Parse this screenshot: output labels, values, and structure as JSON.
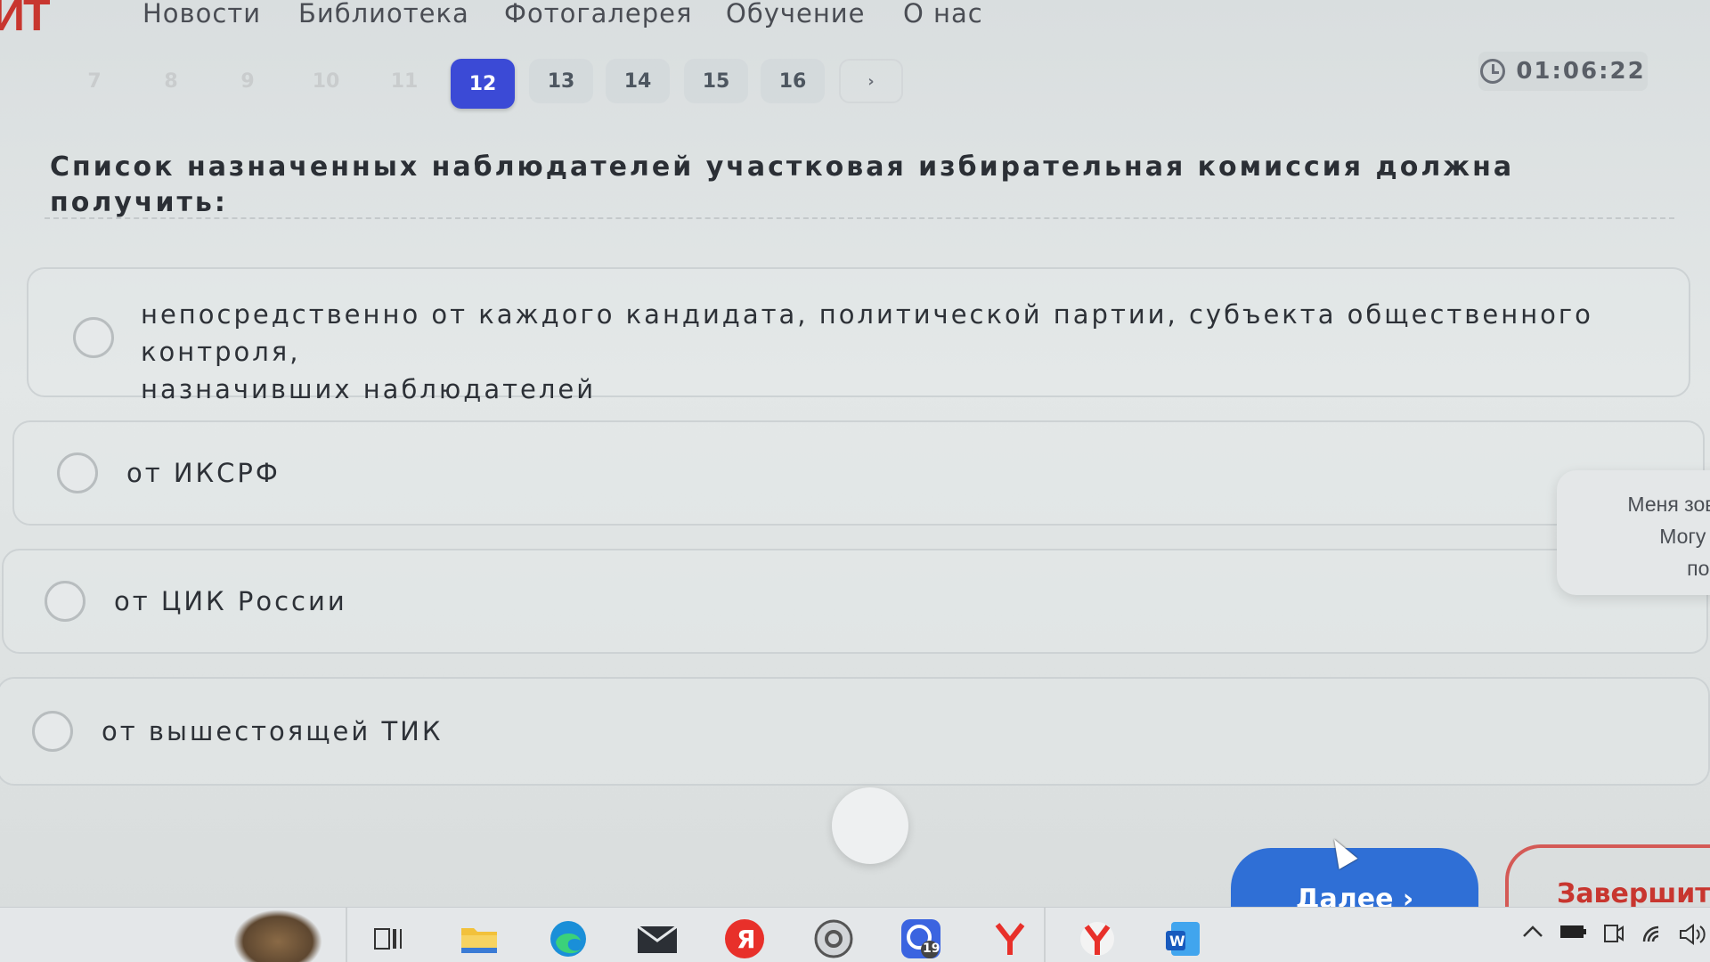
{
  "logo": "ИТ",
  "nav": [
    "Новости",
    "Библиотека",
    "Фотогалерея",
    "Обучение",
    "О нас"
  ],
  "pager": {
    "pages": [
      "7",
      "8",
      "9",
      "10",
      "11",
      "12",
      "13",
      "14",
      "15",
      "16"
    ],
    "active": "12",
    "next": "›"
  },
  "timer": "01:06:22",
  "question": "Список назначенных наблюдателей участковая избирательная комиссия должна получить:",
  "answers": [
    {
      "line1": "непосредственно от каждого кандидата, политической партии, субъекта общественного контроля,",
      "line2": "назначивших наблюдателей"
    },
    {
      "line1": "от ИКСРФ"
    },
    {
      "line1": "от ЦИК России"
    },
    {
      "line1": "от вышестоящей ТИК"
    }
  ],
  "chat": [
    "Меня зовут",
    "Могу ли",
    "помо"
  ],
  "buttons": {
    "next": "Далее ›",
    "finish": "Завершить"
  },
  "taskbar": {
    "badge": "19",
    "icons": [
      "task-view-icon",
      "file-explorer-icon",
      "edge-icon",
      "mail-icon",
      "yandex-icon",
      "settings-icon",
      "messenger-icon",
      "yandex-browser-icon",
      "yandex-browser-icon",
      "word-icon"
    ]
  }
}
